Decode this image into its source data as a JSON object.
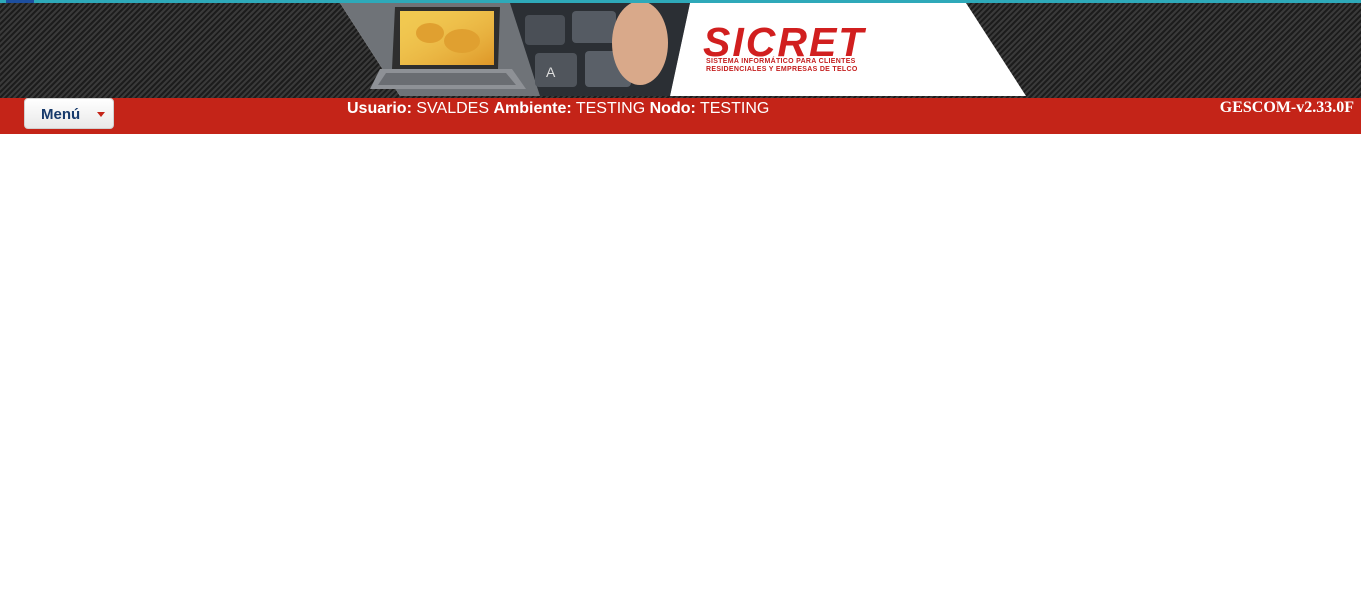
{
  "header": {
    "logo_title": "SICRET",
    "logo_subtitle_line1": "SISTEMA INFORMÁTICO PARA CLIENTES",
    "logo_subtitle_line2": "RESIDENCIALES Y EMPRESAS DE TELCO"
  },
  "toolbar": {
    "menu_label": "Menú",
    "usuario_label": "Usuario:",
    "usuario_value": "SVALDES",
    "ambiente_label": "Ambiente:",
    "ambiente_value": "TESTING",
    "nodo_label": "Nodo:",
    "nodo_value": "TESTING",
    "version": "GESCOM-v2.33.0F"
  },
  "colors": {
    "bar_red": "#c42418",
    "logo_red": "#d11f1f",
    "menu_text": "#173a6b"
  },
  "icons": {
    "menu_caret": "caret-down-icon"
  }
}
